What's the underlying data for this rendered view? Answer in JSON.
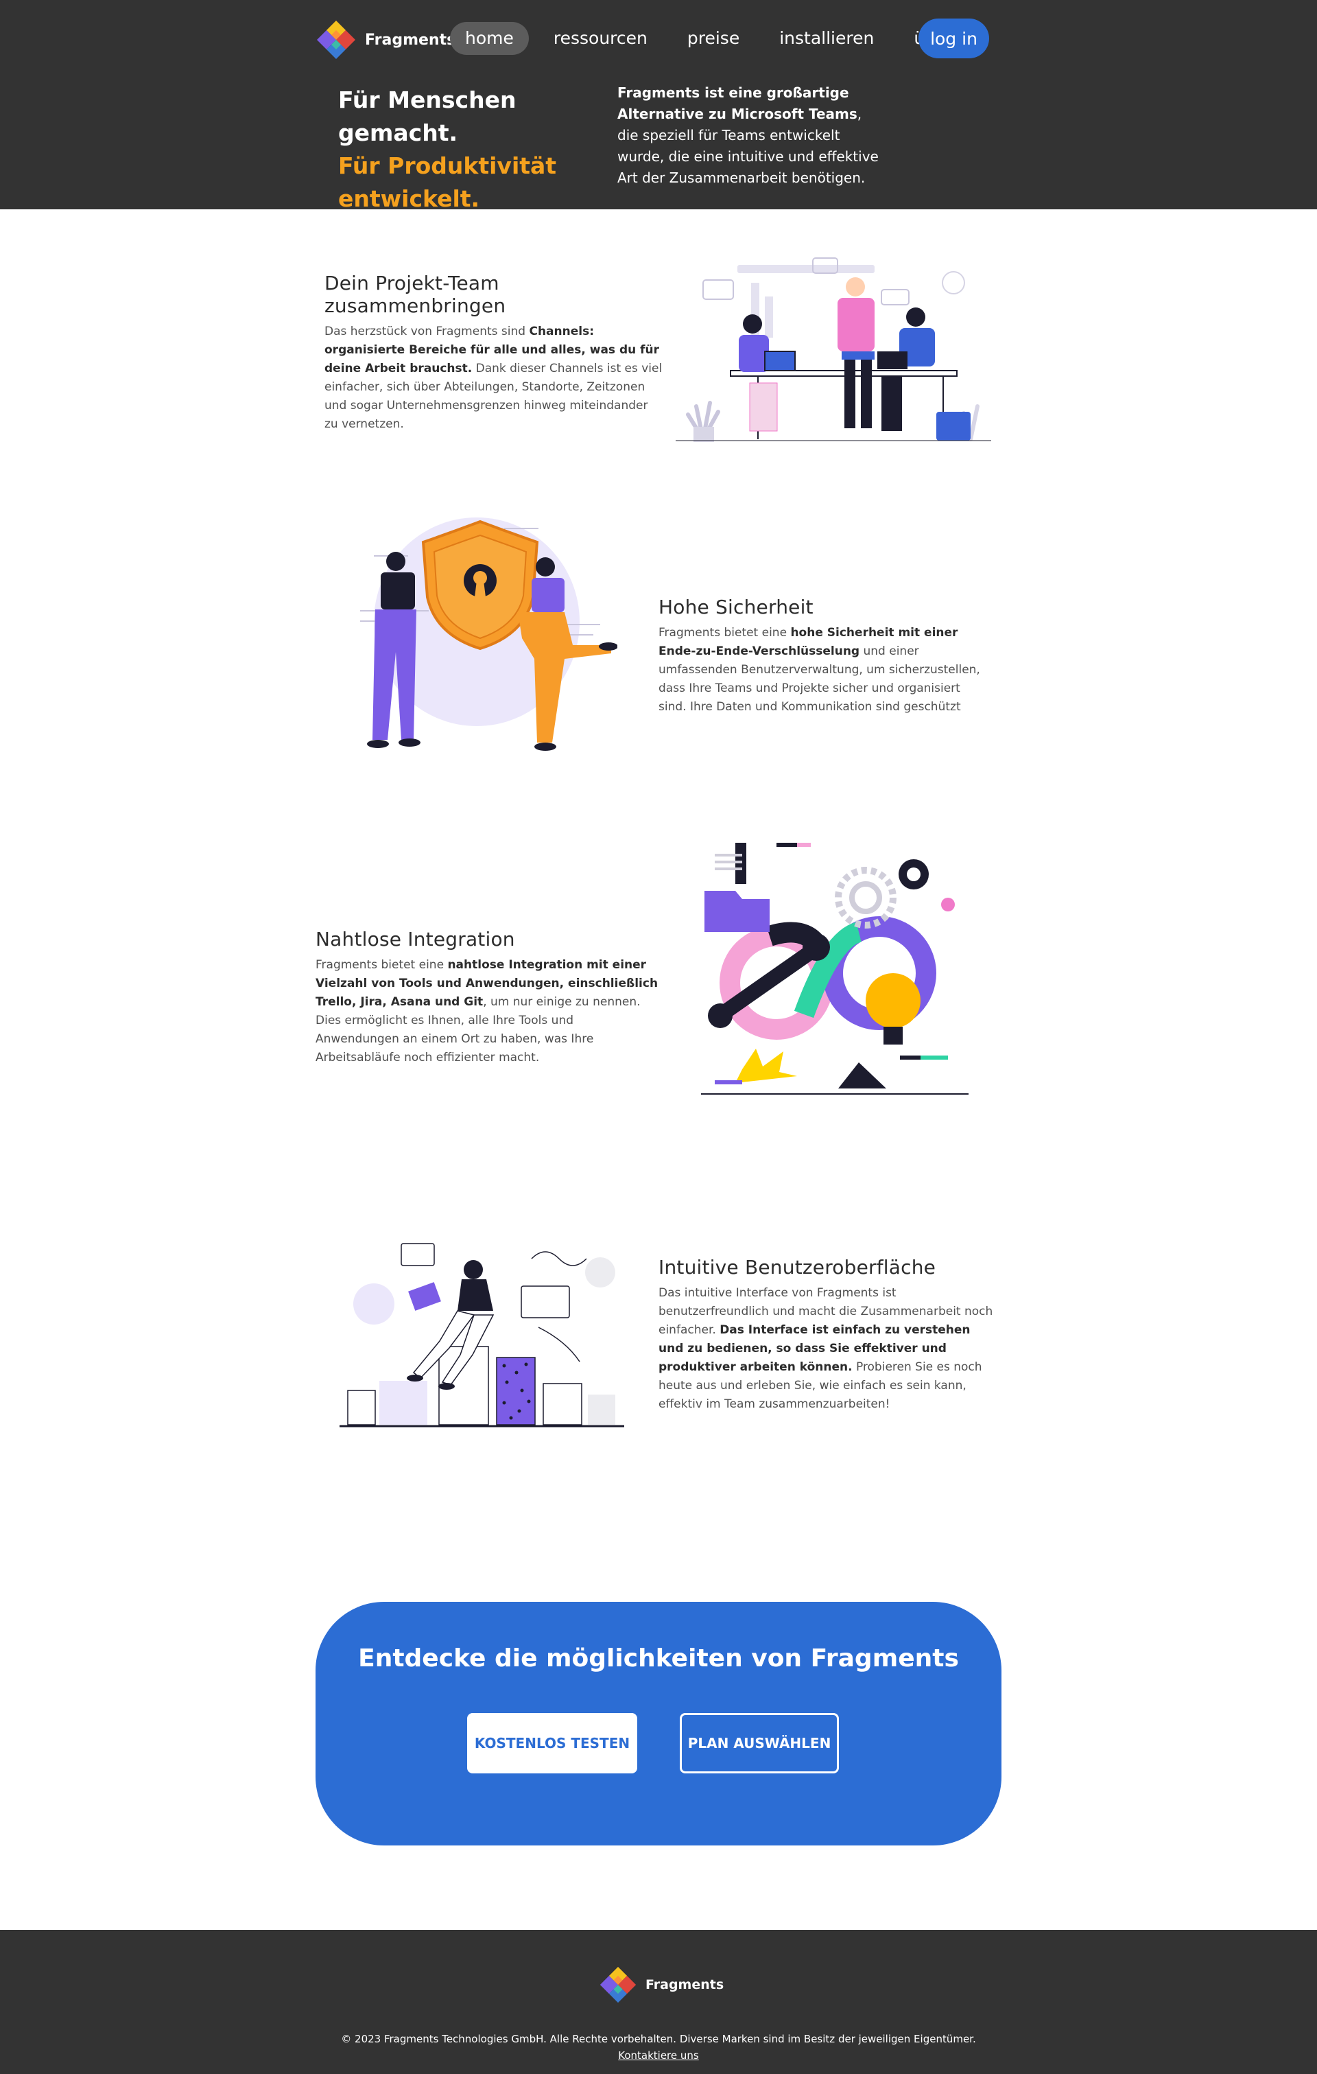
{
  "brand": {
    "name": "Fragments"
  },
  "nav": {
    "items": [
      {
        "label": "home",
        "active": true
      },
      {
        "label": "ressourcen",
        "active": false
      },
      {
        "label": "preise",
        "active": false
      },
      {
        "label": "installieren",
        "active": false
      },
      {
        "label": "über uns",
        "active": false
      }
    ],
    "login_label": "log in"
  },
  "hero": {
    "title_line1": "Für Menschen gemacht.",
    "title_line2": "Für Produktivität entwickelt.",
    "desc_bold": "Fragments ist eine großartige Alternative zu Microsoft Teams",
    "desc_rest": ", die speziell für Teams entwickelt wurde, die eine intuitive und effektive Art der Zusammenarbeit benötigen."
  },
  "features": [
    {
      "title": "Dein Projekt-Team zusammenbringen",
      "p1": "Das herzstück von Fragments sind ",
      "b1": "Channels: organisierte Bereiche für alle und alles, was du für deine Arbeit brauchst.",
      "p2": " Dank dieser Channels ist es viel einfacher, sich über Abteilungen, Standorte, Zeitzonen und sogar Unternehmensgrenzen hinweg miteindander zu vernetzen."
    },
    {
      "title": "Hohe Sicherheit",
      "p1": "Fragments bietet eine ",
      "b1": "hohe Sicherheit mit einer Ende-zu-Ende-Verschlüsselung",
      "p2": " und einer umfassenden Benutzerverwaltung, um sicherzustellen, dass Ihre Teams und Projekte sicher und organisiert  sind. Ihre Daten und Kommunikation sind geschützt"
    },
    {
      "title": "Nahtlose Integration",
      "p1": "Fragments bietet eine ",
      "b1": "nahtlose Integration mit einer Vielzahl von Tools und Anwendungen, einschließlich Trello, Jira, Asana und Git",
      "p2": ", um nur einige zu nennen. Dies ermöglicht es Ihnen, alle Ihre Tools und Anwendungen an einem Ort zu haben, was Ihre Arbeitsabläufe noch effizienter macht."
    },
    {
      "title": "Intuitive Benutzeroberfläche",
      "p1": "Das intuitive Interface von Fragments ist benutzerfreundlich und macht die Zusammenarbeit noch einfacher. ",
      "b1": "Das Interface ist einfach zu verstehen und zu bedienen, so dass Sie effektiver und produktiver arbeiten können.",
      "p2": " Probieren Sie es noch heute aus und erleben Sie, wie einfach es sein kann, effektiv im Team zusammenzuarbeiten!"
    }
  ],
  "cta": {
    "title": "Entdecke die möglichkeiten von Fragments",
    "primary_label": "KOSTENLOS TESTEN",
    "secondary_label": "PLAN AUSWÄHLEN"
  },
  "footer": {
    "copyright": "© 2023 Fragments Technologies GmbH. Alle Rechte vorbehalten. Diverse Marken sind im Besitz der jeweiligen Eigentümer.",
    "contact_label": "Kontaktiere uns"
  },
  "colors": {
    "header_bg": "#333333",
    "accent_orange": "#f5a11e",
    "accent_blue": "#2c6dd4",
    "purple": "#7b5ce6",
    "pink": "#f07ac9"
  }
}
